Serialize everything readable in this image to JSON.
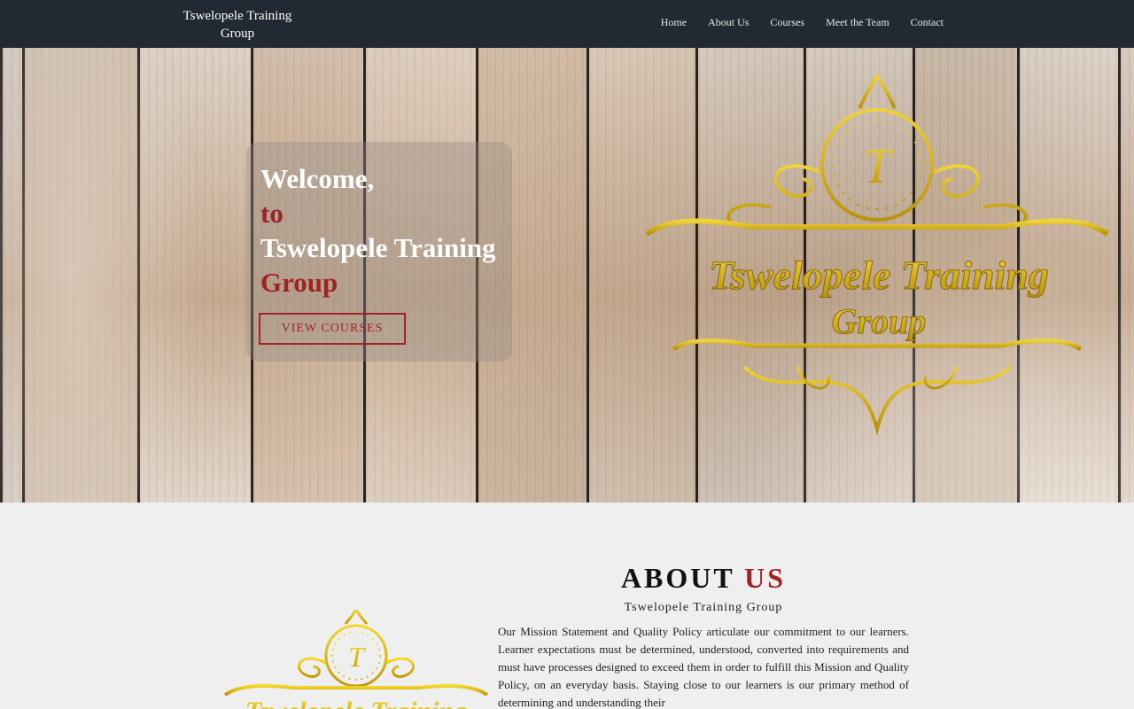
{
  "header": {
    "brand": "Tswelopele Training Group",
    "nav": [
      "Home",
      "About Us",
      "Courses",
      "Meet the Team",
      "Contact"
    ]
  },
  "hero": {
    "line1": "Welcome,",
    "line2": "to",
    "line3": "Tswelopele Training",
    "line4": "Group",
    "cta": "VIEW COURSES",
    "logo_monogram": "T",
    "logo_text_line1": "Tswelopele Training",
    "logo_text_line2": "Group"
  },
  "about": {
    "heading_part1": "ABOUT",
    "heading_part2": "US",
    "subheading": "Tswelopele Training Group",
    "body": "Our Mission Statement and Quality Policy articulate our commitment to our learners. Learner expectations must be determined, understood, converted into requirements and must have processes designed to exceed them in order to fulfill this Mission and Quality Policy, on an everyday basis. Staying close to our learners is our primary method of determining and understanding their",
    "logo_monogram": "T",
    "logo_text": "Tswelopele Training"
  },
  "colors": {
    "navbar": "#212933",
    "accent": "#9e2424",
    "gold": "#d4b20a",
    "page_bg": "#efefef"
  }
}
